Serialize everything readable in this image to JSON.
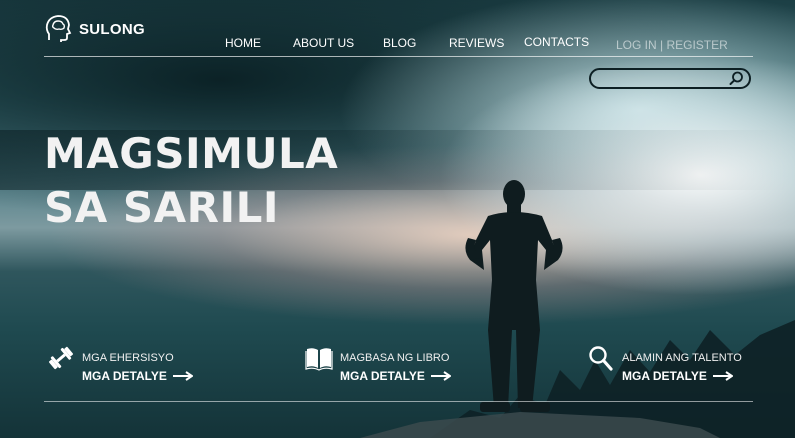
{
  "brand": {
    "name": "SULONG",
    "icon": "head-brain-icon"
  },
  "nav": {
    "items": [
      "HOME",
      "ABOUT US",
      "BLOG",
      "REVIEWS",
      "CONTACTS"
    ],
    "login": "LOG IN | REGISTER"
  },
  "search": {
    "placeholder": "",
    "icon": "search-icon"
  },
  "hero": {
    "line1": "MAGSIMULA",
    "line2": "SA SARILI"
  },
  "features": [
    {
      "icon": "dumbbell-icon",
      "label": "MGA EHERSISYO",
      "link": "MGA DETALYE"
    },
    {
      "icon": "open-book-icon",
      "label": "MAGBASA NG LIBRO",
      "link": "MGA DETALYE"
    },
    {
      "icon": "magnifier-icon",
      "label": "ALAMIN ANG TALENTO",
      "link": "MGA DETALYE"
    }
  ],
  "colors": {
    "text": "#ffffff",
    "search_border": "#0d1f23",
    "sky_teal": "#2d5c63"
  }
}
